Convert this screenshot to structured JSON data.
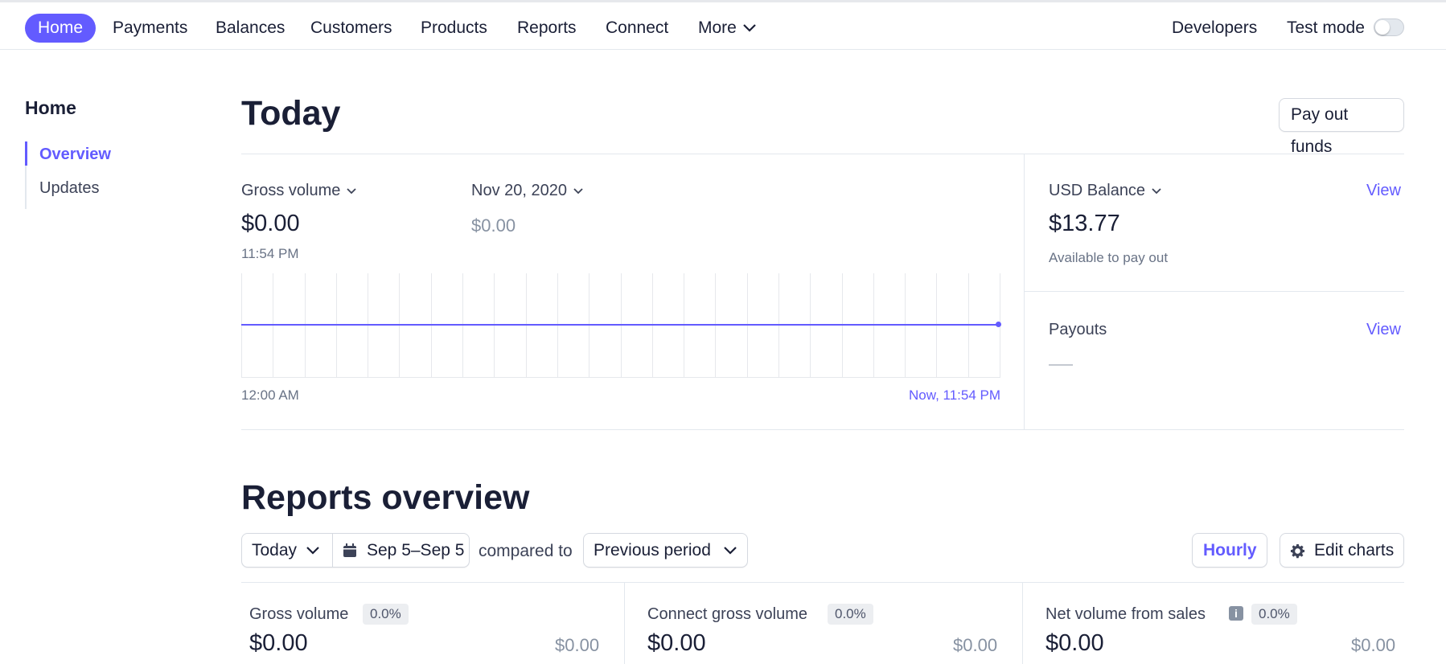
{
  "nav": {
    "items": [
      "Home",
      "Payments",
      "Balances",
      "Customers",
      "Products",
      "Reports",
      "Connect",
      "More"
    ],
    "developers": "Developers",
    "test_mode": "Test mode",
    "test_mode_enabled": false
  },
  "sidebar": {
    "title": "Home",
    "items": [
      "Overview",
      "Updates"
    ],
    "active": "Overview"
  },
  "today": {
    "title": "Today",
    "payout_button": "Pay out funds",
    "metric_label": "Gross volume",
    "metric_value": "$0.00",
    "metric_time": "11:54 PM",
    "compare_label": "Nov 20, 2020",
    "compare_value": "$0.00",
    "chart_start": "12:00 AM",
    "chart_end": "Now, 11:54 PM",
    "balance_label": "USD Balance",
    "balance_view": "View",
    "balance_value": "$13.77",
    "balance_sub": "Available to pay out",
    "payouts_label": "Payouts",
    "payouts_view": "View"
  },
  "chart_data": {
    "type": "line",
    "x": [
      "12:00 AM",
      "Now, 11:54 PM"
    ],
    "series": [
      {
        "values": [
          0,
          0
        ]
      }
    ],
    "grid": true
  },
  "reports": {
    "title": "Reports overview",
    "range": "Today",
    "dates": "Sep 5–Sep 5",
    "compared_to": "compared to",
    "comparison": "Previous period",
    "interval": "Hourly",
    "edit": "Edit charts",
    "cards": [
      {
        "label": "Gross volume",
        "badge": "0.0%",
        "value": "$0.00",
        "prev": "$0.00"
      },
      {
        "label": "Connect gross volume",
        "badge": "0.0%",
        "value": "$0.00",
        "prev": "$0.00"
      },
      {
        "label": "Net volume from sales",
        "badge": "0.0%",
        "value": "$0.00",
        "prev": "$0.00"
      }
    ]
  },
  "colors": {
    "accent": "#635bff",
    "text": "#1a1f36",
    "muted": "#697386",
    "border": "#e3e8ee"
  }
}
